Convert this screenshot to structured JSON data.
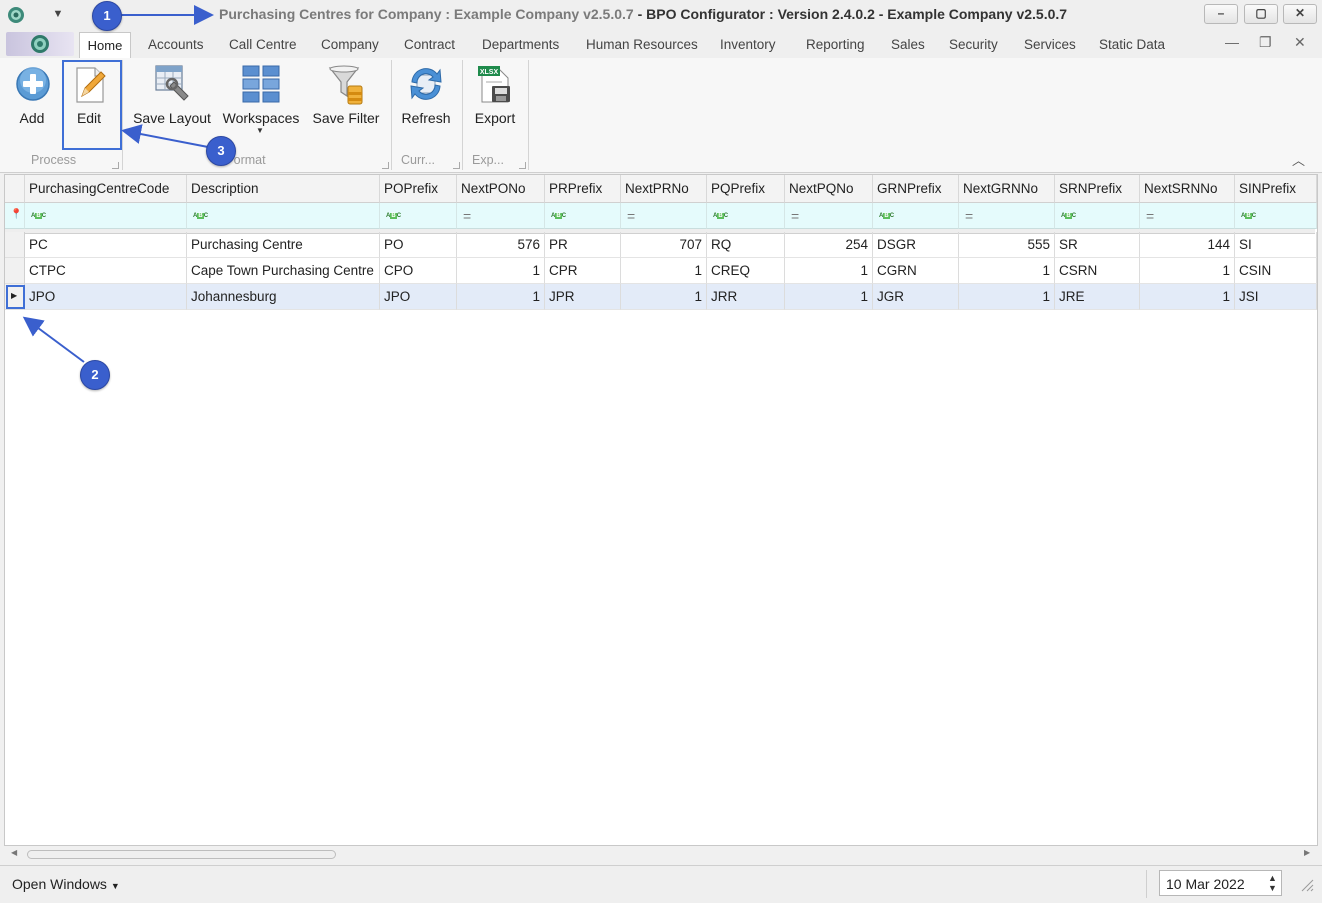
{
  "window": {
    "title_part1": "Purchasing Centres for Company : Example Company v2.5.0.7",
    "title_separator": " - ",
    "title_part2": "BPO Configurator : Version 2.4.0.2 - Example Company v2.5.0.7"
  },
  "tabs": [
    "Home",
    "Accounts",
    "Call Centre",
    "Company",
    "Contract",
    "Departments",
    "Human Resources",
    "Inventory",
    "Reporting",
    "Sales",
    "Security",
    "Services",
    "Static Data"
  ],
  "ribbon": {
    "buttons": {
      "add": "Add",
      "edit": "Edit",
      "save_layout": "Save Layout",
      "workspaces": "Workspaces",
      "save_filter": "Save Filter",
      "refresh": "Refresh",
      "export": "Export"
    },
    "groups": {
      "process": "Process",
      "format": "Format",
      "current": "Curr...",
      "export": "Exp..."
    }
  },
  "grid": {
    "columns": [
      "PurchasingCentreCode",
      "Description",
      "POPrefix",
      "NextPONo",
      "PRPrefix",
      "NextPRNo",
      "PQPrefix",
      "NextPQNo",
      "GRNPrefix",
      "NextGRNNo",
      "SRNPrefix",
      "NextSRNNo",
      "SINPrefix"
    ],
    "rows": [
      [
        "PC",
        "Purchasing Centre",
        "PO",
        "576",
        "PR",
        "707",
        "RQ",
        "254",
        "DSGR",
        "555",
        "SR",
        "144",
        "SI"
      ],
      [
        "CTPC",
        "Cape Town Purchasing Centre",
        "CPO",
        "1",
        "CPR",
        "1",
        "CREQ",
        "1",
        "CGRN",
        "1",
        "CSRN",
        "1",
        "CSIN"
      ],
      [
        "JPO",
        "Johannesburg",
        "JPO",
        "1",
        "JPR",
        "1",
        "JRR",
        "1",
        "JGR",
        "1",
        "JRE",
        "1",
        "JSI"
      ]
    ],
    "selected_row": 2
  },
  "statusbar": {
    "open_windows": "Open Windows",
    "date": "10 Mar 2022"
  },
  "callouts": [
    "1",
    "2",
    "3"
  ],
  "colors": {
    "accent": "#3a5fcd",
    "filter_row": "#e5fbfc",
    "selected_row": "#e3ebf8"
  }
}
